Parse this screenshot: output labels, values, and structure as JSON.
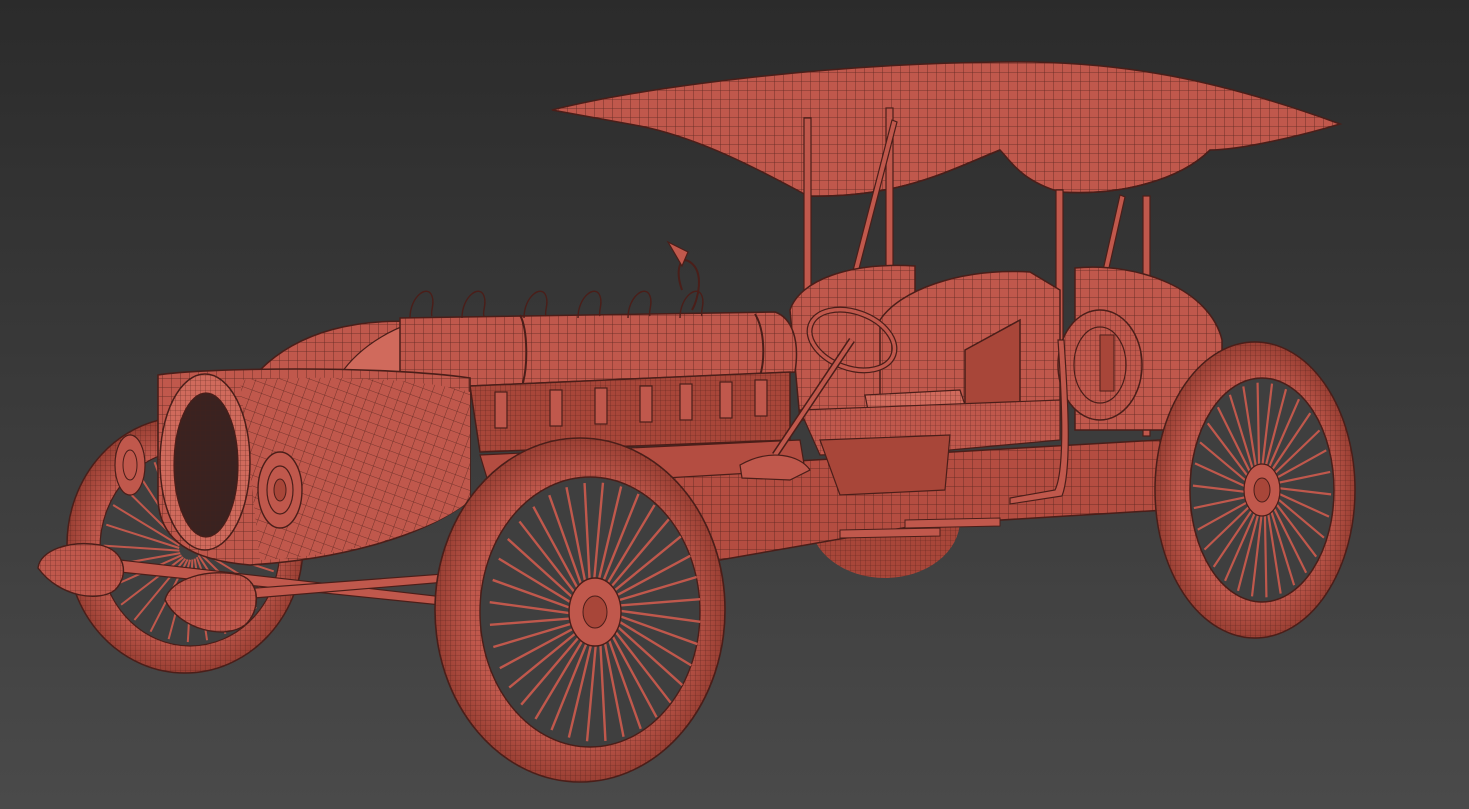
{
  "viewport": {
    "background_top": "#2b2b2b",
    "background_bottom": "#4a4a4a"
  },
  "model": {
    "kind": "vintage race car wireframe render",
    "fill_color": "#c0584c",
    "shade_color": "#a84639",
    "light_color": "#d06a5c",
    "wire_color": "#4a1e19"
  }
}
